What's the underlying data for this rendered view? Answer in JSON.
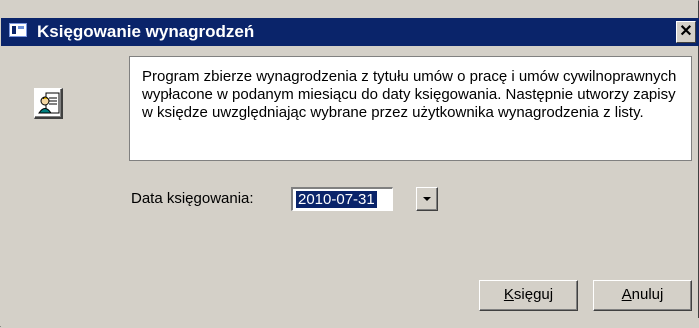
{
  "window": {
    "title": "Księgowanie wynagrodzeń",
    "close_glyph": "✕"
  },
  "info": {
    "icon": "person-document-icon",
    "text": "Program zbierze wynagrodzenia z tytułu umów o pracę i umów cywilnoprawnych wypłacone w podanym miesiącu do daty księgowania. Następnie utworzy zapisy w księdze uwzględniając wybrane przez użytkownika wynagrodzenia z listy."
  },
  "date": {
    "label": "Data księgowania:",
    "value": "2010-07-31"
  },
  "buttons": {
    "book_first": "K",
    "book_rest": "sięguj",
    "cancel_first": "A",
    "cancel_rest": "nuluj"
  },
  "colors": {
    "titlebar": "#0a246a",
    "face": "#d4d0c8",
    "selection": "#0a246a"
  }
}
